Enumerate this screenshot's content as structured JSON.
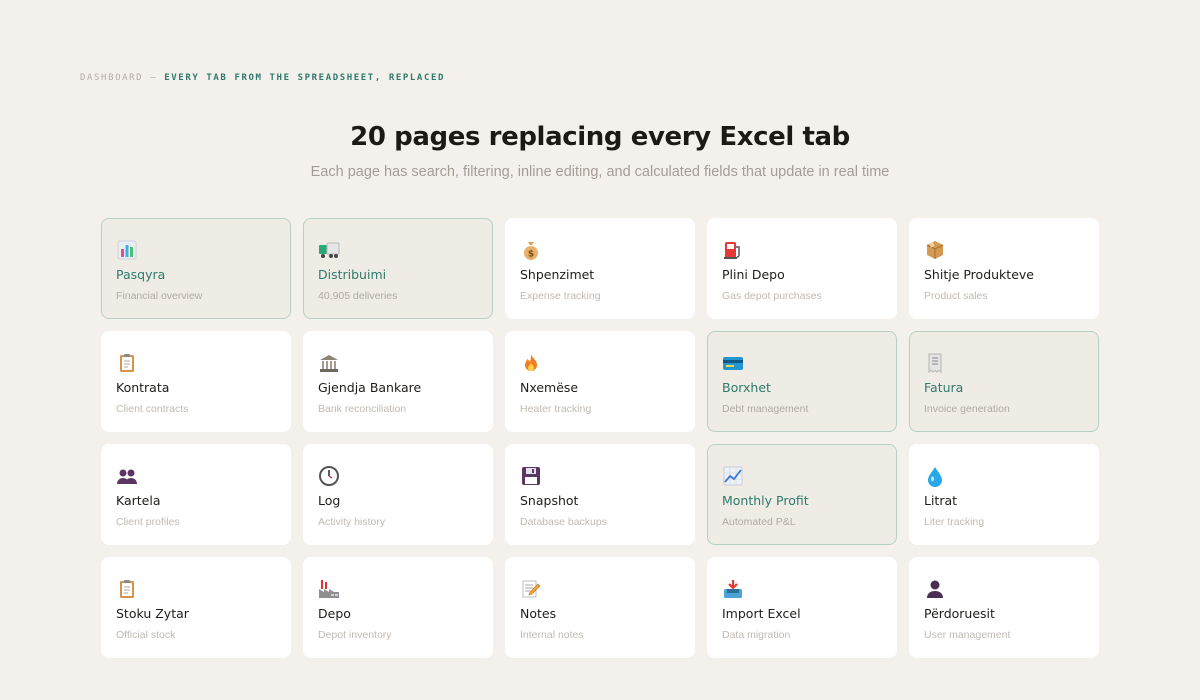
{
  "header": {
    "eyebrow_muted": "DASHBOARD",
    "eyebrow_sep": "—",
    "eyebrow_accent": "EVERY TAB FROM THE SPREADSHEET, REPLACED",
    "title": "20 pages replacing every Excel tab",
    "subtitle": "Each page has search, filtering, inline editing, and calculated fields that update in real time"
  },
  "colors": {
    "background": "#f4f0ec",
    "accent": "#2e7a6c",
    "card": "#ffffff",
    "card_active": "#efece6",
    "card_active_border": "#b7d0c6"
  },
  "pages": [
    {
      "label": "Pasqyra",
      "desc": "Financial overview",
      "icon": "bar-chart-icon",
      "active": true
    },
    {
      "label": "Distribuimi",
      "desc": "40,905 deliveries",
      "icon": "truck-icon",
      "active": true
    },
    {
      "label": "Shpenzimet",
      "desc": "Expense tracking",
      "icon": "money-bag-icon",
      "active": false
    },
    {
      "label": "Plini Depo",
      "desc": "Gas depot purchases",
      "icon": "fuel-pump-icon",
      "active": false
    },
    {
      "label": "Shitje Produkteve",
      "desc": "Product sales",
      "icon": "package-icon",
      "active": false
    },
    {
      "label": "Kontrata",
      "desc": "Client contracts",
      "icon": "clipboard-icon",
      "active": false
    },
    {
      "label": "Gjendja Bankare",
      "desc": "Bank reconciliation",
      "icon": "bank-icon",
      "active": false
    },
    {
      "label": "Nxemëse",
      "desc": "Heater tracking",
      "icon": "fire-icon",
      "active": false
    },
    {
      "label": "Borxhet",
      "desc": "Debt management",
      "icon": "credit-card-icon",
      "active": true
    },
    {
      "label": "Fatura",
      "desc": "Invoice generation",
      "icon": "receipt-icon",
      "active": true
    },
    {
      "label": "Kartela",
      "desc": "Client profiles",
      "icon": "users-icon",
      "active": false
    },
    {
      "label": "Log",
      "desc": "Activity history",
      "icon": "clock-icon",
      "active": false
    },
    {
      "label": "Snapshot",
      "desc": "Database backups",
      "icon": "floppy-disk-icon",
      "active": false
    },
    {
      "label": "Monthly Profit",
      "desc": "Automated P&L",
      "icon": "trending-up-chart-icon",
      "active": true
    },
    {
      "label": "Litrat",
      "desc": "Liter tracking",
      "icon": "droplet-icon",
      "active": false
    },
    {
      "label": "Stoku Zytar",
      "desc": "Official stock",
      "icon": "clipboard-icon",
      "active": false
    },
    {
      "label": "Depo",
      "desc": "Depot inventory",
      "icon": "factory-icon",
      "active": false
    },
    {
      "label": "Notes",
      "desc": "Internal notes",
      "icon": "memo-icon",
      "active": false
    },
    {
      "label": "Import Excel",
      "desc": "Data migration",
      "icon": "inbox-tray-icon",
      "active": false
    },
    {
      "label": "Përdoruesit",
      "desc": "User management",
      "icon": "user-icon",
      "active": false
    }
  ]
}
